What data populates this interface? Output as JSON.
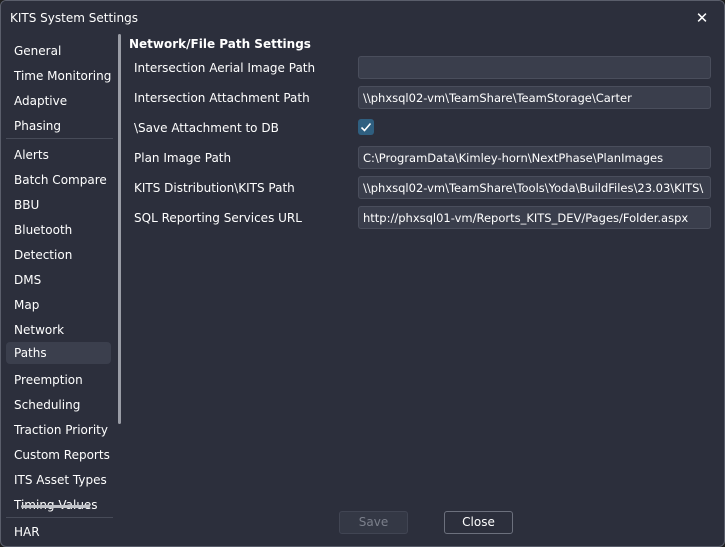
{
  "window": {
    "title": "KITS System Settings"
  },
  "sidebar": {
    "items": [
      {
        "label": "General"
      },
      {
        "label": "Time Monitoring"
      },
      {
        "label": "Adaptive"
      },
      {
        "label": "Phasing"
      },
      {
        "label": "Alerts"
      },
      {
        "label": "Batch Compare"
      },
      {
        "label": "BBU"
      },
      {
        "label": "Bluetooth"
      },
      {
        "label": "Detection"
      },
      {
        "label": "DMS"
      },
      {
        "label": "Map"
      },
      {
        "label": "Network"
      },
      {
        "label": "Paths",
        "selected": true
      },
      {
        "label": "Preemption"
      },
      {
        "label": "Scheduling"
      },
      {
        "label": "Traction Priority"
      },
      {
        "label": "Custom Reports"
      },
      {
        "label": "ITS Asset Types"
      },
      {
        "label": "Timing Values"
      },
      {
        "label": "HAR"
      }
    ]
  },
  "main": {
    "section_title": "Network/File Path Settings",
    "rows": [
      {
        "label": "Intersection Aerial Image Path",
        "value": ""
      },
      {
        "label": "Intersection Attachment Path",
        "value": "\\\\phxsql02-vm\\TeamShare\\TeamStorage\\Carter"
      },
      {
        "label": "\\Save Attachment to DB",
        "checked": true
      },
      {
        "label": "Plan Image Path",
        "value": "C:\\ProgramData\\Kimley-horn\\NextPhase\\PlanImages"
      },
      {
        "label": "KITS Distribution\\KITS Path",
        "value": "\\\\phxsql02-vm\\TeamShare\\Tools\\Yoda\\BuildFiles\\23.03\\KITS\\"
      },
      {
        "label": "SQL Reporting Services URL",
        "value": "http://phxsql01-vm/Reports_KITS_DEV/Pages/Folder.aspx"
      }
    ]
  },
  "footer": {
    "save_label": "Save",
    "close_label": "Close"
  },
  "colors": {
    "background": "#2c2f3c",
    "field": "#3a3e4c",
    "checkbox": "#2f5f80",
    "selected": "#3b3f4d"
  }
}
